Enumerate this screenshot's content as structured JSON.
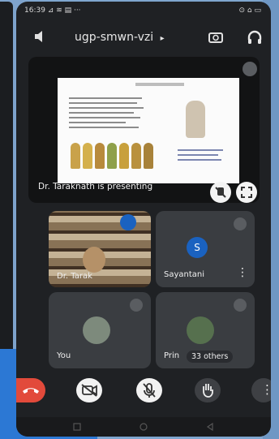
{
  "status_bar": {
    "time": "16:39 ⊿ ≋ ▤ ···",
    "right": "⊙ ⌂ ▭"
  },
  "meeting": {
    "code": "ugp-smwn-vzi",
    "code_caret": "▸"
  },
  "presentation": {
    "label": "Dr. Taraknath is presenting"
  },
  "participants": [
    {
      "name": "Dr. Tarak",
      "kind": "video"
    },
    {
      "name": "Sayantani",
      "initial": "S",
      "avatar_color": "#1a62c0",
      "kind": "avatar"
    },
    {
      "name": "You",
      "kind": "photo"
    },
    {
      "name": "Prin",
      "extra": "33 others",
      "kind": "photo"
    }
  ],
  "more_menu_glyph": "⋮",
  "colors": {
    "end_call": "#e24a3b",
    "tile": "#3a3d41",
    "screen": "#1f2124"
  }
}
